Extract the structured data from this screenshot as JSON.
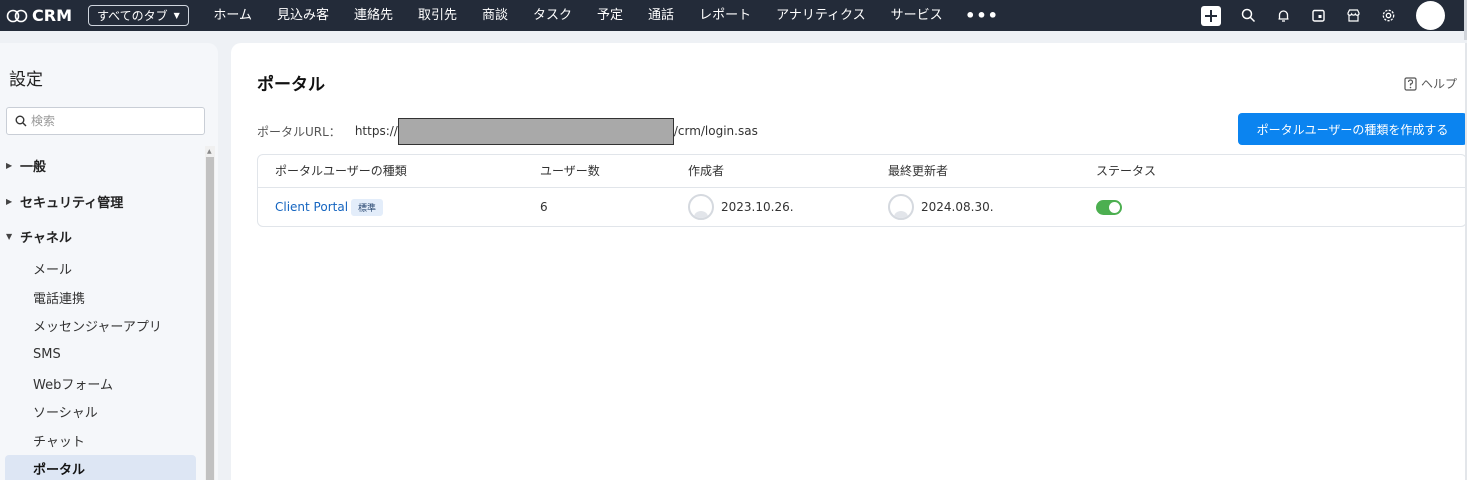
{
  "topbar": {
    "app_name": "CRM",
    "all_tabs_label": "すべてのタブ",
    "nav": [
      "ホーム",
      "見込み客",
      "連絡先",
      "取引先",
      "商談",
      "タスク",
      "予定",
      "通話",
      "レポート",
      "アナリティクス",
      "サービス"
    ],
    "more_label": "•••",
    "icons": [
      "plus-icon",
      "search-icon",
      "bell-icon",
      "calendar-icon",
      "marketplace-icon",
      "gear-icon",
      "avatar"
    ]
  },
  "sidebar": {
    "title": "設定",
    "search_placeholder": "検索",
    "groups": [
      {
        "label": "一般",
        "expanded": false
      },
      {
        "label": "セキュリティ管理",
        "expanded": false
      },
      {
        "label": "チャネル",
        "expanded": true
      }
    ],
    "items": [
      "メール",
      "電話連携",
      "メッセンジャーアプリ",
      "SMS",
      "Webフォーム",
      "ソーシャル",
      "チャット",
      "ポータル"
    ],
    "active_item": "ポータル"
  },
  "main": {
    "title": "ポータル",
    "help_label": "ヘルプ",
    "url_label": "ポータルURL：",
    "url_prefix": "https://",
    "url_suffix": "/crm/login.sas",
    "create_button": "ポータルユーザーの種類を作成する",
    "table": {
      "headers": [
        "ポータルユーザーの種類",
        "ユーザー数",
        "作成者",
        "最終更新者",
        "ステータス"
      ],
      "rows": [
        {
          "name": "Client Portal",
          "badge": "標準",
          "users": "6",
          "created": "2023.10.26.",
          "modified": "2024.08.30.",
          "status_on": true
        }
      ]
    }
  },
  "colors": {
    "topbar": "#232b39",
    "primary_button": "#0b84f0",
    "link": "#1565c0",
    "toggle_on": "#4caf50",
    "active_item_bg": "#dde6f4"
  }
}
